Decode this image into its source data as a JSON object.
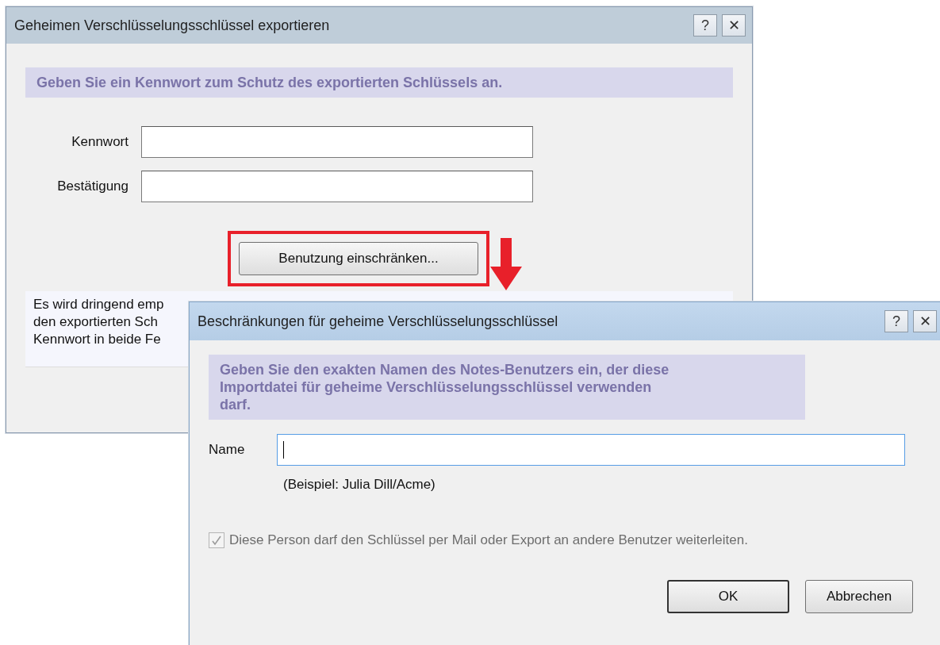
{
  "export_dialog": {
    "title": "Geheimen Verschlüsselungsschlüssel exportieren",
    "help_button": "?",
    "close_button": "✕",
    "instruction": "Geben Sie ein Kennwort zum Schutz des exportierten Schlüssels an.",
    "fields": [
      {
        "label": "Kennwort"
      },
      {
        "label": "Bestätigung"
      }
    ],
    "restrict_button": "Benutzung einschränken...",
    "restrict_button_highlighted": true,
    "note_lines": [
      "Es wird dringend emp",
      "den exportierten Sch",
      "Kennwort in beide Fe"
    ]
  },
  "restrictions_dialog": {
    "title": "Beschränkungen für geheime Verschlüsselungsschlüssel",
    "help_button": "?",
    "close_button": "✕",
    "instruction": "Geben Sie den exakten Namen des Notes-Benutzers ein, der diese Importdatei für geheime Verschlüsselungsschlüssel verwenden darf.",
    "name_label": "Name",
    "name_focused": true,
    "example": "(Beispiel: Julia Dill/Acme)",
    "forward_checkbox": {
      "label": "Diese Person darf den Schlüssel per Mail oder Export an andere Benutzer weiterleiten.",
      "checked": true,
      "disabled": true
    },
    "buttons": [
      {
        "label": "OK",
        "default": true
      },
      {
        "label": "Abbrechen",
        "default": false
      }
    ]
  }
}
